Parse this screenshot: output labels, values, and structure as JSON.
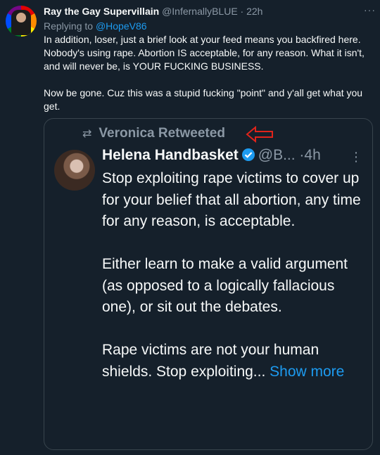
{
  "tweet": {
    "name": "Ray the Gay Supervillain",
    "handle": "@InfernallyBLUE",
    "dot": "·",
    "time": "22h",
    "more": "···",
    "replying_prefix": "Replying to ",
    "replying_handle": "@HopeV86",
    "text": "In addition, loser, just a brief look at your feed means you backfired here. Nobody's using rape. Abortion IS acceptable, for any reason. What it isn't, and will never be, is YOUR FUCKING BUSINESS.\n\nNow be gone. Cuz this was a stupid fucking \"point\" and y'all get what you get."
  },
  "embed": {
    "retweeted_by": "Veronica Retweeted",
    "name": "Helena Handbasket",
    "handle": "@B...",
    "dot": "·",
    "time": "4h",
    "text": "Stop exploiting rape victims to cover up for your belief that all abortion, any time for any reason, is acceptable.\n\nEither learn to make a valid argument (as opposed to a logically fallacious one), or sit out the debates.\n\nRape victims are not your human shields. Stop exploiting... ",
    "show_more": "Show more"
  },
  "colors": {
    "background": "#15202b",
    "text": "#f7f9f9",
    "muted": "#8b98a5",
    "link": "#1d9bf0",
    "annotation_arrow": "#e0241b"
  },
  "icons": [
    "avatar",
    "retweet-icon",
    "verified-badge-icon",
    "more-icon",
    "red-arrow-annotation"
  ]
}
